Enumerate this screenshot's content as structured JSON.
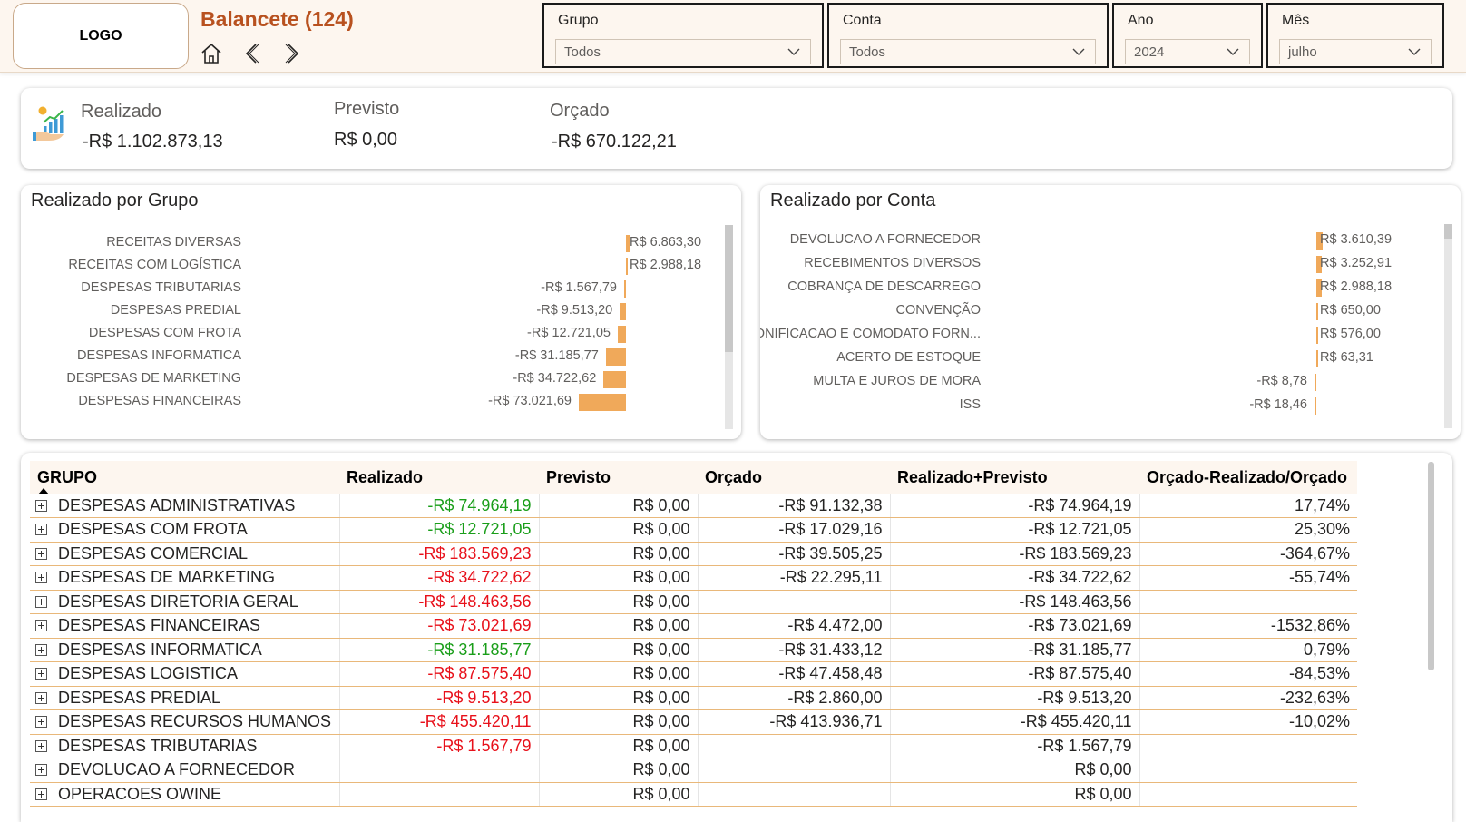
{
  "header": {
    "logo": "LOGO",
    "title": "Balancete (124)",
    "nav": {
      "home_icon": "home-icon",
      "back_icon": "chevron-left-icon",
      "forward_icon": "chevron-right-icon"
    }
  },
  "filters": {
    "grupo": {
      "label": "Grupo",
      "value": "Todos"
    },
    "conta": {
      "label": "Conta",
      "value": "Todos"
    },
    "ano": {
      "label": "Ano",
      "value": "2024"
    },
    "mes": {
      "label": "Mês",
      "value": "julho"
    }
  },
  "kpis": {
    "icon": "money-growth-icon",
    "realizado": {
      "label": "Realizado",
      "value": "-R$ 1.102.873,13"
    },
    "previsto": {
      "label": "Previsto",
      "value": "R$ 0,00"
    },
    "orcado": {
      "label": "Orçado",
      "value": "-R$ 670.122,21"
    }
  },
  "colors": {
    "accent": "#b8511f",
    "bar": "#f0a95a",
    "positive": "#1a9e1a",
    "negative": "#e8111b",
    "row_line": "#e9b87a",
    "header_bg": "#fdf6ef"
  },
  "chart_data": [
    {
      "type": "bar",
      "orientation": "horizontal",
      "title": "Realizado por Grupo",
      "categories": [
        "RECEITAS DIVERSAS",
        "RECEITAS COM LOGÍSTICA",
        "DESPESAS TRIBUTARIAS",
        "DESPESAS PREDIAL",
        "DESPESAS COM FROTA",
        "DESPESAS INFORMATICA",
        "DESPESAS DE MARKETING",
        "DESPESAS FINANCEIRAS"
      ],
      "values": [
        6863.3,
        2988.18,
        -1567.79,
        -9513.2,
        -12721.05,
        -31185.77,
        -34722.62,
        -73021.69
      ],
      "labels": [
        "R$ 6.863,30",
        "R$ 2.988,18",
        "-R$ 1.567,79",
        "-R$ 9.513,20",
        "-R$ 12.721,05",
        "-R$ 31.185,77",
        "-R$ 34.722,62",
        "-R$ 73.021,69"
      ]
    },
    {
      "type": "bar",
      "orientation": "horizontal",
      "title": "Realizado por Conta",
      "categories": [
        "DEVOLUCAO A FORNECEDOR",
        "RECEBIMENTOS DIVERSOS",
        "COBRANÇA DE DESCARREGO",
        "CONVENÇÃO",
        "BONIFICACAO E COMODATO FORN...",
        "ACERTO DE ESTOQUE",
        "MULTA E JUROS DE MORA",
        "ISS"
      ],
      "values": [
        3610.39,
        3252.91,
        2988.18,
        650.0,
        576.0,
        63.31,
        -8.78,
        -18.46
      ],
      "labels": [
        "R$ 3.610,39",
        "R$ 3.252,91",
        "R$ 2.988,18",
        "R$ 650,00",
        "R$ 576,00",
        "R$ 63,31",
        "-R$ 8,78",
        "-R$ 18,46"
      ]
    }
  ],
  "table": {
    "headers": [
      "GRUPO",
      "Realizado",
      "Previsto",
      "Orçado",
      "Realizado+Previsto",
      "Orçado-Realizado/Orçado"
    ],
    "rows": [
      {
        "grupo": "DESPESAS ADMINISTRATIVAS",
        "realizado": "-R$ 74.964,19",
        "status": "pos",
        "previsto": "R$ 0,00",
        "orcado": "-R$ 91.132,38",
        "real_prev": "-R$ 74.964,19",
        "pct": "17,74%"
      },
      {
        "grupo": "DESPESAS COM FROTA",
        "realizado": "-R$ 12.721,05",
        "status": "pos",
        "previsto": "R$ 0,00",
        "orcado": "-R$ 17.029,16",
        "real_prev": "-R$ 12.721,05",
        "pct": "25,30%"
      },
      {
        "grupo": "DESPESAS COMERCIAL",
        "realizado": "-R$ 183.569,23",
        "status": "neg",
        "previsto": "R$ 0,00",
        "orcado": "-R$ 39.505,25",
        "real_prev": "-R$ 183.569,23",
        "pct": "-364,67%"
      },
      {
        "grupo": "DESPESAS DE MARKETING",
        "realizado": "-R$ 34.722,62",
        "status": "neg",
        "previsto": "R$ 0,00",
        "orcado": "-R$ 22.295,11",
        "real_prev": "-R$ 34.722,62",
        "pct": "-55,74%"
      },
      {
        "grupo": "DESPESAS DIRETORIA GERAL",
        "realizado": "-R$ 148.463,56",
        "status": "neg",
        "previsto": "R$ 0,00",
        "orcado": "",
        "real_prev": "-R$ 148.463,56",
        "pct": ""
      },
      {
        "grupo": "DESPESAS FINANCEIRAS",
        "realizado": "-R$ 73.021,69",
        "status": "neg",
        "previsto": "R$ 0,00",
        "orcado": "-R$ 4.472,00",
        "real_prev": "-R$ 73.021,69",
        "pct": "-1532,86%"
      },
      {
        "grupo": "DESPESAS INFORMATICA",
        "realizado": "-R$ 31.185,77",
        "status": "pos",
        "previsto": "R$ 0,00",
        "orcado": "-R$ 31.433,12",
        "real_prev": "-R$ 31.185,77",
        "pct": "0,79%"
      },
      {
        "grupo": "DESPESAS LOGISTICA",
        "realizado": "-R$ 87.575,40",
        "status": "neg",
        "previsto": "R$ 0,00",
        "orcado": "-R$ 47.458,48",
        "real_prev": "-R$ 87.575,40",
        "pct": "-84,53%"
      },
      {
        "grupo": "DESPESAS PREDIAL",
        "realizado": "-R$ 9.513,20",
        "status": "neg",
        "previsto": "R$ 0,00",
        "orcado": "-R$ 2.860,00",
        "real_prev": "-R$ 9.513,20",
        "pct": "-232,63%"
      },
      {
        "grupo": "DESPESAS RECURSOS HUMANOS",
        "realizado": "-R$ 455.420,11",
        "status": "neg",
        "previsto": "R$ 0,00",
        "orcado": "-R$ 413.936,71",
        "real_prev": "-R$ 455.420,11",
        "pct": "-10,02%"
      },
      {
        "grupo": "DESPESAS TRIBUTARIAS",
        "realizado": "-R$ 1.567,79",
        "status": "neg",
        "previsto": "R$ 0,00",
        "orcado": "",
        "real_prev": "-R$ 1.567,79",
        "pct": ""
      },
      {
        "grupo": "DEVOLUCAO A FORNECEDOR",
        "realizado": "",
        "status": "",
        "previsto": "R$ 0,00",
        "orcado": "",
        "real_prev": "R$ 0,00",
        "pct": ""
      },
      {
        "grupo": "OPERACOES OWINE",
        "realizado": "",
        "status": "",
        "previsto": "R$ 0,00",
        "orcado": "",
        "real_prev": "R$ 0,00",
        "pct": ""
      }
    ]
  }
}
